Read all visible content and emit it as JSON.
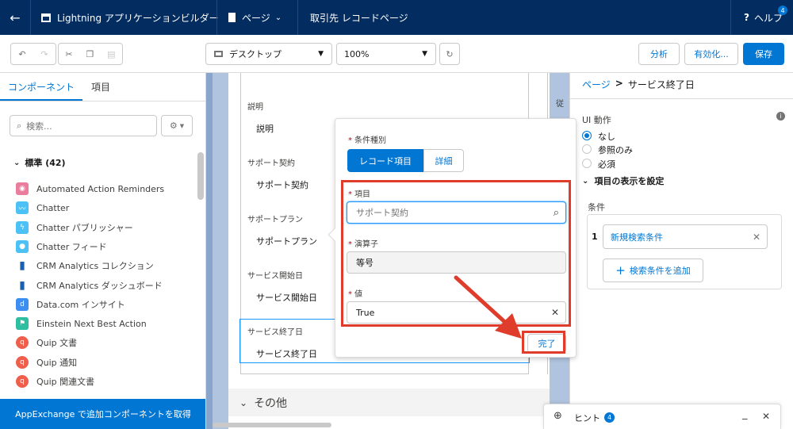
{
  "header": {
    "app_title": "Lightning アプリケーションビルダー",
    "page_menu": "ページ",
    "record_page": "取引先 レコードページ",
    "help": "ヘルプ",
    "help_badge": "4"
  },
  "toolbar": {
    "device": "デスクトップ",
    "zoom": "100%",
    "analyze": "分析",
    "activate": "有効化...",
    "save": "保存"
  },
  "left": {
    "tab_components": "コンポーネント",
    "tab_fields": "項目",
    "search_placeholder": "検索...",
    "section": "標準 (42)",
    "components": [
      {
        "label": "Automated Action Reminders",
        "icon": "bell-icon",
        "color": "#ea7d9c"
      },
      {
        "label": "Chatter",
        "icon": "wave-icon",
        "color": "#4bc1f5"
      },
      {
        "label": "Chatter パブリッシャー",
        "icon": "bolt-icon",
        "color": "#4bc1f5"
      },
      {
        "label": "Chatter フィード",
        "icon": "chat-icon",
        "color": "#4bc1f5"
      },
      {
        "label": "CRM Analytics コレクション",
        "icon": "bar-chart-icon",
        "color": "#1b5fb2"
      },
      {
        "label": "CRM Analytics ダッシュボード",
        "icon": "bar-chart-icon",
        "color": "#1b5fb2"
      },
      {
        "label": "Data.com インサイト",
        "icon": "d-icon",
        "color": "#3d8ef1"
      },
      {
        "label": "Einstein Next Best Action",
        "icon": "flag-icon",
        "color": "#2fbfa0"
      },
      {
        "label": "Quip 文書",
        "icon": "quip-icon",
        "color": "#f05f4b"
      },
      {
        "label": "Quip 通知",
        "icon": "quip-icon",
        "color": "#f05f4b"
      },
      {
        "label": "Quip 関連文書",
        "icon": "quip-icon",
        "color": "#f05f4b"
      }
    ],
    "appexchange": "AppExchange で追加コンポーネントを取得"
  },
  "canvas": {
    "fields": [
      {
        "label": "説明",
        "value": "説明"
      },
      {
        "label": "サポート契約",
        "value": "サポート契約"
      },
      {
        "label": "サポートプラン",
        "value": "サポートプラン"
      },
      {
        "label": "サービス開始日",
        "value": "サービス開始日"
      },
      {
        "label": "サービス終了日",
        "value": "サービス終了日"
      }
    ],
    "right_partial": "従",
    "other_section": "その他"
  },
  "popover": {
    "condition_type_label": "条件種別",
    "tab_record": "レコード項目",
    "tab_detail": "詳細",
    "field_label": "項目",
    "field_value": "サポート契約",
    "operator_label": "演算子",
    "operator_value": "等号",
    "value_label": "値",
    "value_value": "True",
    "done": "完了"
  },
  "right": {
    "breadcrumb_page": "ページ",
    "breadcrumb_sep": ">",
    "breadcrumb_item": "サービス終了日",
    "ui_behavior_label": "UI 動作",
    "radio_none": "なし",
    "radio_readonly": "参照のみ",
    "radio_required": "必須",
    "visibility_heading": "項目の表示を設定",
    "conditions_label": "条件",
    "condition_number": "1",
    "condition_new": "新規検索条件",
    "add_condition": "検索条件を追加"
  },
  "hint": {
    "label": "ヒント",
    "badge": "4"
  },
  "colors": {
    "header_bg": "#032d60",
    "brand_blue": "#0176d3",
    "highlight_red": "#e03c2b"
  }
}
